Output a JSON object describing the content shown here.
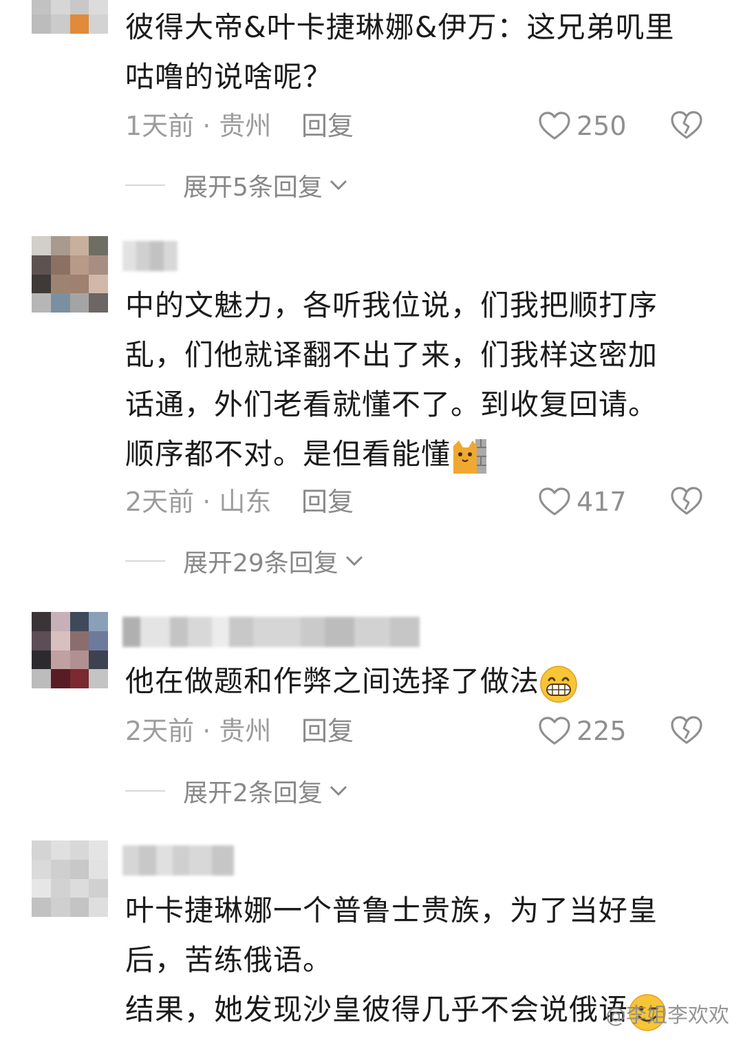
{
  "comments": [
    {
      "text_lines": [
        "彼得大帝&叶卡捷琳娜&伊万：这兄弟叽里",
        "咕噜的说啥呢？"
      ],
      "time_location": "1天前 · 贵州",
      "reply_label": "回复",
      "likes": "250",
      "expand_label": "展开5条回复"
    },
    {
      "text_lines": [
        "中的文魅力，各听我位说，们我把顺打序",
        "乱，们他就译翻不出了来，们我样这密加",
        "话通，外们老看就懂不了。到收复回请。",
        "顺序都不对。是但看能懂"
      ],
      "time_location": "2天前 · 山东",
      "reply_label": "回复",
      "likes": "417",
      "expand_label": "展开29条回复"
    },
    {
      "text_lines": [
        "他在做题和作弊之间选择了做法"
      ],
      "time_location": "2天前 · 贵州",
      "reply_label": "回复",
      "likes": "225",
      "expand_label": "展开2条回复"
    },
    {
      "text_lines": [
        "叶卡捷琳娜一个普鲁士贵族，为了当好皇",
        "后，苦练俄语。",
        "结果，她发现沙皇彼得几乎不会说俄语"
      ]
    }
  ],
  "watermark": "@李姐李欢欢",
  "icons": {
    "like": "heart-outline-icon",
    "dislike": "broken-heart-icon",
    "expand": "chevron-down-icon",
    "emoji_cat": "peeking-cat-emoji",
    "emoji_grin": "grinning-face-emoji",
    "emoji_wink": "winking-face-emoji"
  },
  "colors": {
    "text": "#1b1b1b",
    "meta": "#9c9c9c",
    "emoji_yellow": "#f5b82e"
  }
}
